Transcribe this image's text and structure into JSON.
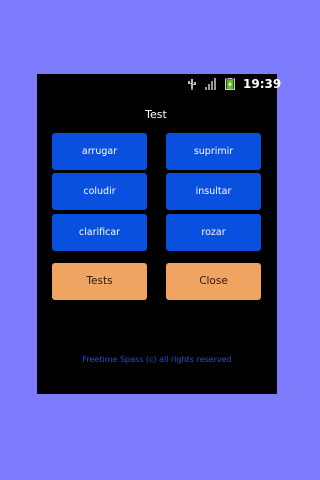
{
  "status_bar": {
    "time": "19:39",
    "icons": [
      "usb-icon",
      "signal-icon",
      "battery-charging-icon"
    ]
  },
  "app": {
    "title": "Test"
  },
  "words": {
    "items": [
      {
        "label": "arrugar"
      },
      {
        "label": "suprimir"
      },
      {
        "label": "coludir"
      },
      {
        "label": "insultar"
      },
      {
        "label": "clarificar"
      },
      {
        "label": "rozar"
      }
    ]
  },
  "actions": {
    "tests_label": "Tests",
    "close_label": "Close"
  },
  "footer": {
    "text": "Freetime Spass (c) all rights reserved"
  },
  "colors": {
    "page_background": "#7d7bfc",
    "screen_background": "#000000",
    "word_button": "#0a50df",
    "action_button": "#efa462",
    "footer_text": "#1f4fd9"
  }
}
